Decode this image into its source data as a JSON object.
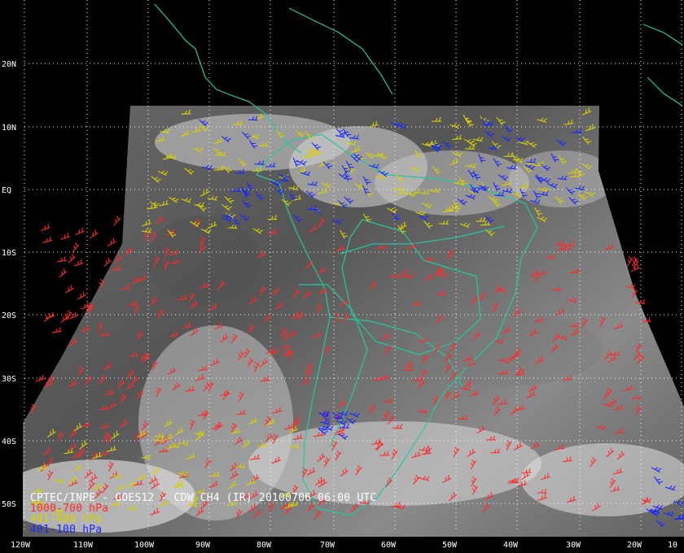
{
  "title": "CPTEC/INPE - GOES12 - CDW CH4 (IR) 20100706 06:00 UTC",
  "legend": [
    {
      "label": "1000-700 hPa",
      "color": "#ff2a2a"
    },
    {
      "label": "401-400 hPa",
      "color": "#d8d000"
    },
    {
      "label": "401-100 hPa",
      "color": "#1828ff"
    }
  ],
  "lon_labels": [
    "120W",
    "110W",
    "100W",
    "90W",
    "80W",
    "70W",
    "60W",
    "50W",
    "40W",
    "30W",
    "20W",
    "10"
  ],
  "lat_labels": [
    "20N",
    "10N",
    "EQ",
    "10S",
    "20S",
    "30S",
    "40S",
    "50S"
  ],
  "colors": {
    "background": "#000000",
    "coastline": "#24c8a0",
    "grid": "#ffffff",
    "satellite_light": "#9a9a9a",
    "satellite_dark": "#555555"
  }
}
